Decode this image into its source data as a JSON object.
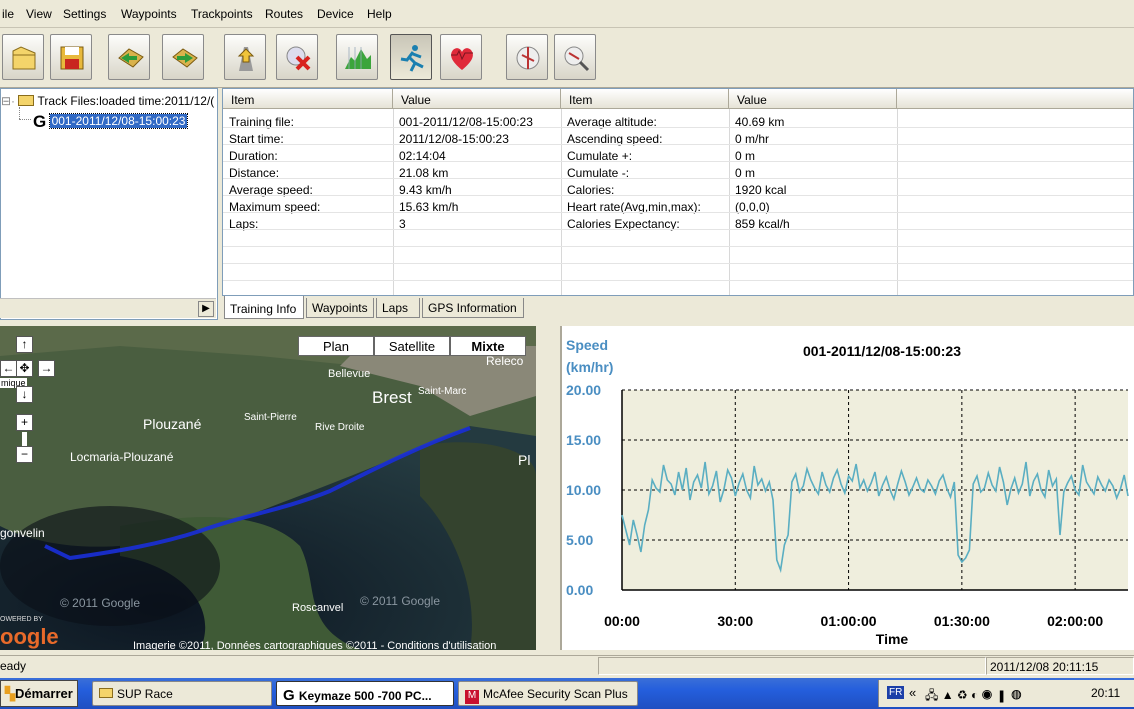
{
  "menu": [
    "ile",
    "View",
    "Settings",
    "Waypoints",
    "Trackpoints",
    "Routes",
    "Device",
    "Help"
  ],
  "toolbar": [
    "open-folder-icon",
    "save-icon",
    "back-arrow-icon",
    "forward-arrow-icon",
    "upload-icon",
    "delete-icon",
    "altitude-chart-icon",
    "speed-runner-icon",
    "heart-rate-icon",
    "map-globe-icon",
    "zoom-globe-icon"
  ],
  "tree": {
    "root": "Track Files:loaded time:2011/12/(",
    "child": "001-2011/12/08-15:00:23"
  },
  "grid": {
    "headers": [
      "Item",
      "Value",
      "Item",
      "Value"
    ],
    "rows": [
      [
        "Training file:",
        "001-2011/12/08-15:00:23",
        "Average altitude:",
        "40.69 km"
      ],
      [
        "Start time:",
        "2011/12/08-15:00:23",
        "Ascending speed:",
        "0     m/hr"
      ],
      [
        "Duration:",
        "02:14:04",
        "Cumulate +:",
        "0 m"
      ],
      [
        "Distance:",
        "21.08 km",
        "Cumulate -:",
        "0 m"
      ],
      [
        "Average speed:",
        "9.43 km/h",
        "Calories:",
        "1920 kcal"
      ],
      [
        "Maximum speed:",
        "15.63 km/h",
        "Heart rate(Avg,min,max):",
        "(0,0,0)"
      ],
      [
        "Laps:",
        "3",
        "Calories Expectancy:",
        "859  kcal/h"
      ]
    ]
  },
  "tabs": [
    "Training Info",
    "Waypoints",
    "Laps",
    "GPS Information"
  ],
  "map": {
    "buttons": [
      "Plan",
      "Satellite",
      "Mixte"
    ],
    "labels": [
      "Bellevue",
      "Brest",
      "Saint-Marc",
      "Le Releco",
      "Plouzané",
      "Saint-Pierre",
      "Rive Droite",
      "Locmaria-Plouzané",
      "Pl",
      "gonvelin",
      "Roscanvel"
    ],
    "powered": "OWERED BY",
    "logo": "oogle",
    "copyright1": "© 2011 Google",
    "copyright2": "© 2011 Google",
    "attribution": "Imagerie ©2011, Données cartographiques ©2011 - Conditions d'utilisation",
    "nav": {
      "up": "↑",
      "left": "←",
      "right": "→",
      "down": "↓",
      "zoom_in": "+",
      "zoom_out": "−",
      "fragment": "mique"
    }
  },
  "chart_data": {
    "type": "line",
    "title": "001-2011/12/08-15:00:23",
    "ylabel": "Speed (km/hr)",
    "ylabel_lines": [
      "Speed",
      "(km/hr)"
    ],
    "xlabel": "Time",
    "ylim": [
      0,
      20
    ],
    "xlim_minutes": [
      0,
      134
    ],
    "yticks": [
      "20.00",
      "15.00",
      "10.00",
      "5.00",
      "0.00"
    ],
    "xticks": [
      "00:00",
      "30:00",
      "01:00:00",
      "01:30:00",
      "02:00:00"
    ],
    "grid": true,
    "series": [
      {
        "values": [
          7.5,
          6.0,
          4.5,
          7.0,
          5.5,
          3.8,
          6.5,
          8.0,
          11.0,
          10.2,
          9.8,
          12.5,
          11.0,
          10.6,
          9.5,
          11.8,
          10.0,
          12.2,
          9.0,
          10.8,
          11.5,
          10.2,
          12.8,
          9.6,
          10.4,
          11.9,
          8.8,
          10.1,
          12.0,
          11.2,
          9.4,
          10.7,
          11.6,
          10.0,
          9.2,
          12.4,
          10.5,
          11.1,
          9.9,
          10.8,
          9.0,
          3.0,
          2.0,
          4.5,
          5.5,
          10.8,
          11.6,
          9.8,
          10.4,
          12.1,
          11.0,
          10.2,
          9.6,
          11.8,
          10.5,
          9.8,
          11.2,
          12.0,
          10.6,
          9.7,
          11.4,
          10.9,
          12.6,
          10.2,
          11.0,
          9.9,
          10.7,
          11.8,
          9.4,
          10.5,
          11.3,
          10.0,
          9.1,
          10.6,
          11.9,
          10.8,
          9.5,
          10.3,
          11.2,
          10.1,
          9.8,
          11.0,
          10.4,
          9.6,
          10.9,
          11.5,
          10.2,
          9.3,
          10.8,
          3.5,
          2.8,
          3.2,
          4.0,
          10.6,
          11.4,
          9.8,
          10.2,
          11.7,
          10.5,
          9.9,
          12.3,
          10.8,
          8.5,
          10.1,
          11.2,
          9.7,
          10.6,
          12.8,
          9.4,
          10.9,
          11.6,
          10.0,
          9.3,
          12.0,
          10.4,
          11.1,
          5.5,
          9.8,
          10.7,
          11.4,
          10.0,
          9.5,
          12.5,
          10.8,
          10.2,
          9.6,
          11.3,
          10.5,
          9.9,
          11.0,
          10.4,
          9.2,
          10.1,
          11.5,
          9.4
        ]
      }
    ]
  },
  "status": {
    "left": "eady",
    "right": "2011/12/08 20:11:15"
  },
  "taskbar": {
    "start": "Démarrer",
    "tasks": [
      "SUP Race",
      "Keymaze 500 -700 PC...",
      "McAfee Security Scan Plus"
    ],
    "lang": "FR",
    "chevron": "«",
    "clock": "20:11"
  }
}
